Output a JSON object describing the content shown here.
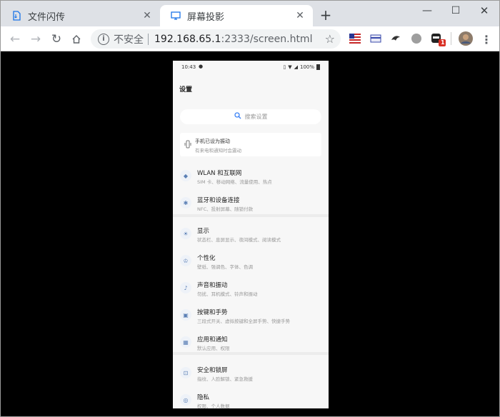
{
  "tabs": [
    {
      "title": "文件闪传",
      "active": false
    },
    {
      "title": "屏幕投影",
      "active": true
    }
  ],
  "address": {
    "insecure_label": "不安全",
    "host": "192.168.65.1",
    "path": ":2333/screen.html"
  },
  "extension_badge": "1",
  "colors": {
    "accent": "#1a73e8",
    "tab_strip": "#dee1e6",
    "background": "#000000",
    "badge": "#d93025"
  },
  "phone": {
    "status": {
      "time": "10:43",
      "battery": "100%"
    },
    "page_title": "设置",
    "search_placeholder": "搜索设置",
    "vibration_notice": {
      "title": "手机已设为振动",
      "subtitle": "有来电和通知时会震动"
    },
    "items": [
      {
        "label": "WLAN 和互联网",
        "sub": "SIM 卡、移动网络、流量使用、热点",
        "icon": "wifi-icon",
        "glyph": "◆"
      },
      {
        "label": "蓝牙和设备连接",
        "sub": "NFC、投射屏幕、随锁付款",
        "icon": "bluetooth-icon",
        "glyph": "✱"
      },
      {
        "label": "显示",
        "sub": "状态栏、息屏显示、夜间模式、阅读模式",
        "icon": "brightness-icon",
        "glyph": "☀"
      },
      {
        "label": "个性化",
        "sub": "壁纸、强调色、字体、色调",
        "icon": "shirt-icon",
        "glyph": "♔"
      },
      {
        "label": "声音和振动",
        "sub": "勿扰、耳机模式、铃声和振动",
        "icon": "speaker-icon",
        "glyph": "♪"
      },
      {
        "label": "按键和手势",
        "sub": "三段式开关、虚拟按键和全屏手势、快捷手势",
        "icon": "keys-icon",
        "glyph": "▣"
      },
      {
        "label": "应用和通知",
        "sub": "默认应用、权限",
        "icon": "apps-icon",
        "glyph": "▦"
      },
      {
        "label": "安全和锁屏",
        "sub": "指纹、人脸解锁、紧急救援",
        "icon": "lock-icon",
        "glyph": "⊡"
      },
      {
        "label": "隐私",
        "sub": "权限、个人数据",
        "icon": "privacy-icon",
        "glyph": "◎"
      }
    ]
  }
}
